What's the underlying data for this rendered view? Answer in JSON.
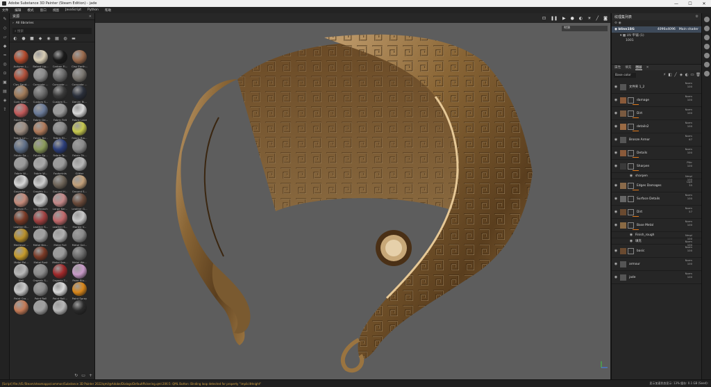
{
  "window": {
    "title": "Adobe Substance 3D Painter (Steam Edition) - jade",
    "controls": [
      "—",
      "☐",
      "✕"
    ]
  },
  "menu": [
    "文件",
    "编辑",
    "模式",
    "窗口",
    "视图",
    "JavaScript",
    "Python",
    "帮助"
  ],
  "shelf": {
    "title": "资源",
    "library": "All libraries",
    "search_placeholder": "搜索",
    "materials": [
      {
        "label": "Autumn L...",
        "color": "#b34a2c"
      },
      {
        "label": "Baked Lig...",
        "color": "#d8cdb4"
      },
      {
        "label": "Carbon Fi...",
        "color": "#1a1a1a"
      },
      {
        "label": "Clay Earth...",
        "color": "#9a6a4c"
      },
      {
        "label": "Clay Sand...",
        "color": "#b0503a"
      },
      {
        "label": "Concrete ...",
        "color": "#8a8a8a"
      },
      {
        "label": "Concrete ...",
        "color": "#6a6a6a"
      },
      {
        "label": "Concrete ...",
        "color": "#7a7670"
      },
      {
        "label": "Cork Natr...",
        "color": "#a07a58"
      },
      {
        "label": "Custom S...",
        "color": "#6a6a6a"
      },
      {
        "label": "Custom S...",
        "color": "#3a3a3a"
      },
      {
        "label": "Denim Ri...",
        "color": "#2a2f3a"
      },
      {
        "label": "Fabric Co...",
        "color": "#c25a5a"
      },
      {
        "label": "Fabric De...",
        "color": "#6a7a98"
      },
      {
        "label": "Fabric Felt",
        "color": "#9a9a9a"
      },
      {
        "label": "Fabric Lace",
        "color": "#d8d8d8"
      },
      {
        "label": "Fabric Lin...",
        "color": "#9e8e82"
      },
      {
        "label": "Fabric Ny...",
        "color": "#b07a5a"
      },
      {
        "label": "Fabric Ri...",
        "color": "#8a8a8a"
      },
      {
        "label": "Fabric Rip...",
        "color": "#c6c84e"
      },
      {
        "label": "Fabric Sa...",
        "color": "#5e6e86"
      },
      {
        "label": "Fabric Sp...",
        "color": "#8a9a5a"
      },
      {
        "label": "Fabric Te...",
        "color": "#2c3e7a"
      },
      {
        "label": "Fabric Tri...",
        "color": "#8a8a8a"
      },
      {
        "label": "Fabric W...",
        "color": "#9a9a9a"
      },
      {
        "label": "Fabric W...",
        "color": "#a8a8a8"
      },
      {
        "label": "Footprints",
        "color": "#9a9a9a"
      },
      {
        "label": "Glitter",
        "color": "#b8b8b8"
      },
      {
        "label": "Gouache ...",
        "color": "#d6d6d6"
      },
      {
        "label": "Graphic L...",
        "color": "#cccccc"
      },
      {
        "label": "Ground H...",
        "color": "#6e6458"
      },
      {
        "label": "Ground S...",
        "color": "#c2a07a"
      },
      {
        "label": "Human F...",
        "color": "#c48a7a"
      },
      {
        "label": "Ivy Branch",
        "color": "#c8c8c8"
      },
      {
        "label": "Large Ker...",
        "color": "#c48888"
      },
      {
        "label": "Leather G...",
        "color": "#6a4a3a"
      },
      {
        "label": "Leather B...",
        "color": "#7a3a26"
      },
      {
        "label": "Leather S...",
        "color": "#a04040"
      },
      {
        "label": "Leather S...",
        "color": "#c0686a"
      },
      {
        "label": "Marble V...",
        "color": "#c8c8c8"
      },
      {
        "label": "Medieval ...",
        "color": "#b8902a"
      },
      {
        "label": "Metal Bro...",
        "color": "#a0a0a0"
      },
      {
        "label": "Metal Foil",
        "color": "#b0b0b0"
      },
      {
        "label": "Metal Gal...",
        "color": "#8a8a8a"
      },
      {
        "label": "Metal Pol...",
        "color": "#c59a2a"
      },
      {
        "label": "Metal Rust",
        "color": "#7a3a26"
      },
      {
        "label": "Metal San...",
        "color": "#9a9a9a"
      },
      {
        "label": "Metal We...",
        "color": "#6a6a6a"
      },
      {
        "label": "Nail",
        "color": "#b8b8b8"
      },
      {
        "label": "Organic S...",
        "color": "#8a8a8a"
      },
      {
        "label": "Organic T...",
        "color": "#a0282a"
      },
      {
        "label": "Paint Blu...",
        "color": "#c89ac8"
      },
      {
        "label": "Paint Cra...",
        "color": "#c8c8c8"
      },
      {
        "label": "Paint Roll",
        "color": "#8a8a8a"
      },
      {
        "label": "Paint Roll...",
        "color": "#d8d8d8"
      },
      {
        "label": "Paint Spray",
        "color": "#d8861a"
      },
      {
        "label": "",
        "color": "#c47a56"
      },
      {
        "label": "",
        "color": "#a0a0a0"
      },
      {
        "label": "",
        "color": "#b8b8b8"
      },
      {
        "label": "",
        "color": "#2a2a2a"
      }
    ]
  },
  "viewport": {
    "display_mode": "材质"
  },
  "texture_set": {
    "title": "纹理集列表",
    "name": "blinn1SG",
    "resolution": "4096x4096",
    "shader": "Main shader",
    "uv_label": "UV 平铺 (1)",
    "uv_tile": "1001"
  },
  "layers_panel": {
    "tabs": [
      "属性",
      "填充",
      "图层"
    ],
    "active_tab": "图层",
    "blend_mode": "Base color",
    "layers": [
      {
        "name": "文件夹 1_2",
        "blend": "Norm",
        "opacity": "100",
        "thumb": "#555555",
        "eye": true,
        "type": "folder"
      },
      {
        "name": "damage",
        "blend": "Norm",
        "opacity": "100",
        "thumb": "#8a5a3a",
        "eye": true,
        "type": "fill",
        "bar": true
      },
      {
        "name": "Dirt",
        "blend": "Norm",
        "opacity": "100",
        "thumb": "#7a5a40",
        "eye": true,
        "type": "fill",
        "bar": true
      },
      {
        "name": "details2",
        "blend": "Norm",
        "opacity": "100",
        "thumb": "#9a6a44",
        "eye": true,
        "type": "fill",
        "bar": true
      },
      {
        "name": "Bronze Armor",
        "blend": "Norm",
        "opacity": "67",
        "thumb": "#555555",
        "eye": true,
        "type": "folder"
      },
      {
        "name": "Details",
        "blend": "Norm",
        "opacity": "100",
        "thumb": "#8a5a3a",
        "eye": true,
        "type": "fill",
        "bar": true
      },
      {
        "name": "Sharpen",
        "blend": "Pthr",
        "opacity": "100",
        "thumb": "#3a3a3a",
        "eye": true,
        "type": "filter",
        "bar": true
      },
      {
        "name": "sharpen",
        "blend": "Nmpl",
        "opacity": "100",
        "sub": true
      },
      {
        "name": "Edges Damages",
        "blend": "Ligh",
        "opacity": "35",
        "thumb": "#8a6a4a",
        "eye": true,
        "type": "fill",
        "bar": true
      },
      {
        "name": "Surface Details",
        "blend": "Norm",
        "opacity": "100",
        "thumb": "#666666",
        "eye": true,
        "type": "fill"
      },
      {
        "name": "Dirt",
        "blend": "Norm",
        "opacity": "57",
        "thumb": "#6a4a30",
        "eye": true,
        "type": "fill",
        "bar": true
      },
      {
        "name": "Base Metal",
        "blend": "Norm",
        "opacity": "100",
        "thumb": "#8a6a44",
        "eye": true,
        "type": "fill",
        "bar": true
      },
      {
        "name": "Finish_rough",
        "blend": "Nmpl",
        "opacity": "100",
        "sub": true
      },
      {
        "name": "填充",
        "blend": "Norm",
        "opacity": "100",
        "sub": true
      },
      {
        "name": "basic",
        "blend": "Norm",
        "opacity": "100",
        "thumb": "#6a4a30",
        "eye": true,
        "type": "fill"
      },
      {
        "name": "armour",
        "blend": "Norm",
        "opacity": "100",
        "thumb": "#555555",
        "eye": true,
        "type": "folder"
      },
      {
        "name": "jade",
        "blend": "Norm",
        "opacity": "100",
        "thumb": "#555555",
        "eye": true,
        "type": "folder"
      }
    ]
  },
  "status": {
    "message": "[Script] file:///E:/Steam/steamapps/common/Substance 3D Painter 2022/qml/@Adobe/Dialogs/DefaultPickering.qml:206:5: QML Button: Binding loop detected for property \"implicitHeight\"",
    "right": "显示加速状态显示: 13% 缓存: 0.1 GB (Seed):"
  },
  "colors": {
    "accent_orange": "#e0791a",
    "selection": "#3e4a5a",
    "viewport_bg": "#5d5d5d",
    "bronze": "#8a6636"
  }
}
